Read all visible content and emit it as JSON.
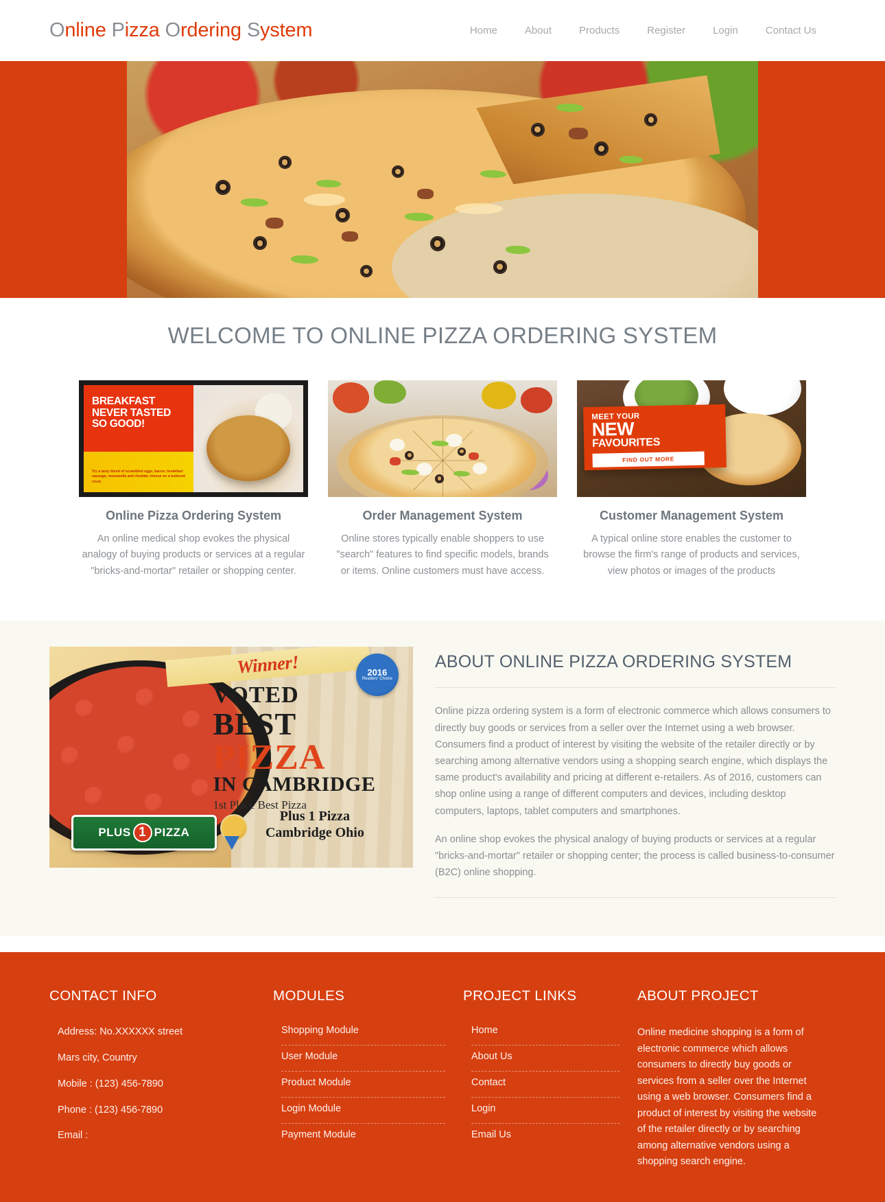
{
  "header": {
    "brand_parts": [
      {
        "cap": "O",
        "rest": "nline"
      },
      {
        "cap": "P",
        "rest": "izza"
      },
      {
        "cap": "O",
        "rest": "rdering"
      },
      {
        "cap": "S",
        "rest": "ystem"
      }
    ],
    "brand_full": "Online Pizza Ordering System",
    "nav": [
      {
        "label": "Home"
      },
      {
        "label": "About"
      },
      {
        "label": "Products"
      },
      {
        "label": "Register"
      },
      {
        "label": "Login"
      },
      {
        "label": "Contact Us"
      }
    ]
  },
  "hero": {
    "image_alt": "pizza-hero-image"
  },
  "welcome": {
    "title": "WELCOME TO ONLINE PIZZA ORDERING SYSTEM",
    "cards": [
      {
        "image_alt": "breakfast-pizza-ad-image",
        "title": "Online Pizza Ordering System",
        "text": "An online medical shop evokes the physical analogy of buying products or services at a regular \"bricks-and-mortar\" retailer or shopping center.",
        "ad": {
          "line1": "BREAKFAST",
          "line2": "NEVER TASTED",
          "line3": "SO GOOD!",
          "fine": "Try a tasty blend of scrambled eggs, bacon, breakfast sausage, mozzarella and cheddar cheese on a buttered crust."
        }
      },
      {
        "image_alt": "veggie-pizza-image",
        "title": "Order Management System",
        "text": "Online stores typically enable shoppers to use \"search\" features to find specific models, brands or items. Online customers must have access."
      },
      {
        "image_alt": "new-favourites-ad-image",
        "title": "Customer Management System",
        "text": "A typical online store enables the customer to browse the firm's range of products and services, view photos or images of the products",
        "ad": {
          "meet": "MEET YOUR",
          "new": "NEW",
          "fav": "FAVOURITES",
          "button": "FIND OUT MORE"
        }
      }
    ]
  },
  "about": {
    "image_alt": "voted-best-pizza-poster",
    "poster": {
      "winner": "Winner!",
      "seal_year": "2016",
      "seal_text": "Readers' Choice",
      "voted": "VOTED",
      "best": "BEST",
      "pizza": "PIZZA",
      "in_cambridge": "IN CAMBRIDGE",
      "first_place": "1st Place Best Pizza",
      "brand": "PLUS 1 PIZZA",
      "brand_one": "1",
      "brand_left": "PLUS",
      "brand_right": "PIZZA",
      "location": "Plus 1 Pizza\nCambridge Ohio"
    },
    "title": "ABOUT ONLINE PIZZA ORDERING SYSTEM",
    "paragraphs": [
      "Online pizza ordering system is a form of electronic commerce which allows consumers to directly buy goods or services from a seller over the Internet using a web browser. Consumers find a product of interest by visiting the website of the retailer directly or by searching among alternative vendors using a shopping search engine, which displays the same product's availability and pricing at different e-retailers. As of 2016, customers can shop online using a range of different computers and devices, including desktop computers, laptops, tablet computers and smartphones.",
      "An online shop evokes the physical analogy of buying products or services at a regular \"bricks-and-mortar\" retailer or shopping center; the process is called business-to-consumer (B2C) online shopping."
    ]
  },
  "footer": {
    "contact": {
      "title": "CONTACT INFO",
      "lines": [
        "Address: No.XXXXXX street",
        "Mars city, Country",
        "Mobile : (123) 456-7890",
        "Phone : (123) 456-7890",
        "Email :"
      ]
    },
    "modules": {
      "title": "MODULES",
      "items": [
        "Shopping Module",
        "User Module",
        "Product Module",
        "Login Module",
        "Payment Module"
      ]
    },
    "links": {
      "title": "PROJECT LINKS",
      "items": [
        "Home",
        "About Us",
        "Contact",
        "Login",
        "Email Us"
      ]
    },
    "about": {
      "title": "ABOUT PROJECT",
      "text": "Online medicine shopping is a form of electronic commerce which allows consumers to directly buy goods or services from a seller over the Internet using a web browser. Consumers find a product of interest by visiting the website of the retailer directly or by searching among alternative vendors using a shopping search engine."
    }
  },
  "colors": {
    "brand_orange": "#d63f10",
    "logo_orange": "#e03c0a",
    "logo_gray": "#8a8f94",
    "heading_gray": "#767f87",
    "about_heading": "#53606e",
    "body_gray": "#8a8e90",
    "about_bg": "#f9f9f2"
  }
}
